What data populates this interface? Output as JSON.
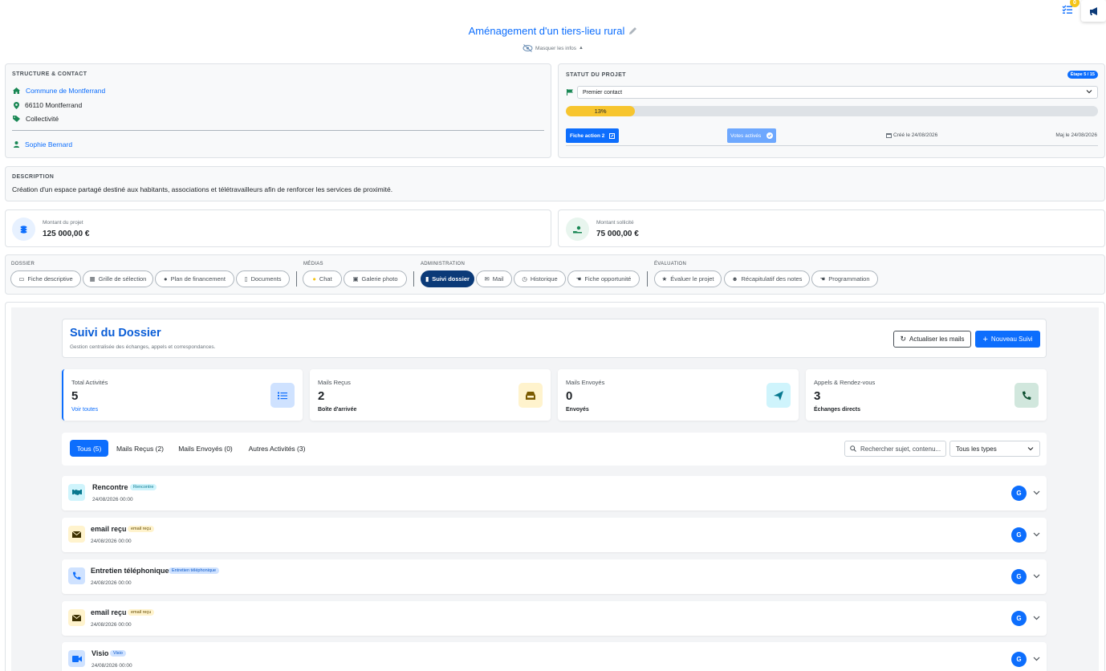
{
  "topbar": {
    "badge_count": "0"
  },
  "header": {
    "title": "Aménagement d'un tiers-lieu rural",
    "hide_info": "Masquer les infos"
  },
  "structure": {
    "heading": "STRUCTURE & CONTACT",
    "commune": "Commune de Montferrand",
    "address": "66110 Montferrand",
    "type": "Collectivité",
    "contact": "Sophie Bernard"
  },
  "status": {
    "heading": "STATUT DU PROJET",
    "step_badge": "Étape 5 / 15",
    "select_value": "Premier contact",
    "progress_label": "13%",
    "progress_value": 0.13,
    "fiche_button": "Fiche action 2",
    "votes_button": "Votes activés",
    "created": "Créé le 24/08/2026",
    "updated": "Maj le 24/08/2026"
  },
  "description": {
    "heading": "DESCRIPTION",
    "text": "Création d'un espace partagé destiné aux habitants, associations et télétravailleurs afin de renforcer les services de proximité."
  },
  "amounts": {
    "project_label": "Montant du projet",
    "project_value": "125 000,00 €",
    "requested_label": "Montant sollicité",
    "requested_value": "75 000,00 €"
  },
  "nav": {
    "groups": {
      "dossier": "DOSSIER",
      "medias": "MÉDIAS",
      "administration": "ADMINISTRATION",
      "evaluation": "ÉVALUATION"
    },
    "fiche_descriptive": "Fiche descriptive",
    "grille": "Grille de sélection",
    "plan": "Plan de financement",
    "documents": "Documents",
    "chat": "Chat",
    "galerie": "Galerie photo",
    "suivi": "Suivi dossier",
    "mail": "Mail",
    "historique": "Historique",
    "fiche_opportunite": "Fiche opportunité",
    "evaluer": "Évaluer le projet",
    "recap": "Récapitulatif des notes",
    "programmation": "Programmation"
  },
  "suivi": {
    "title": "Suivi du Dossier",
    "subtitle": "Gestion centralisée des échanges, appels et correspondances.",
    "refresh_button": "Actualiser les mails",
    "new_button": "Nouveau Suivi"
  },
  "stats": [
    {
      "label": "Total Activités",
      "value": "5",
      "sub": "Voir toutes"
    },
    {
      "label": "Mails Reçus",
      "value": "2",
      "sub": "Boîte d'arrivée"
    },
    {
      "label": "Mails Envoyés",
      "value": "0",
      "sub": "Envoyés"
    },
    {
      "label": "Appels & Rendez-vous",
      "value": "3",
      "sub": "Échanges directs"
    }
  ],
  "filters": {
    "tabs": [
      "Tous (5)",
      "Mails Reçus (2)",
      "Mails Envoyés (0)",
      "Autres Activités (3)"
    ],
    "search_placeholder": "Rechercher sujet, contenu...",
    "type_select": "Tous les types"
  },
  "activities": [
    {
      "title": "Rencontre",
      "badge": "Rencontre",
      "date": "24/08/2026 00:00",
      "avatar": "G"
    },
    {
      "title": "email reçu",
      "badge": "email reçu",
      "date": "24/08/2026 00:00",
      "avatar": "G"
    },
    {
      "title": "Entretien téléphonique",
      "badge": "Entretien téléphonique",
      "date": "24/08/2026 00:00",
      "avatar": "G"
    },
    {
      "title": "email reçu",
      "badge": "email reçu",
      "date": "24/08/2026 00:00",
      "avatar": "G"
    },
    {
      "title": "Visio",
      "badge": "Visio",
      "date": "24/08/2026 00:00",
      "avatar": "G"
    }
  ]
}
